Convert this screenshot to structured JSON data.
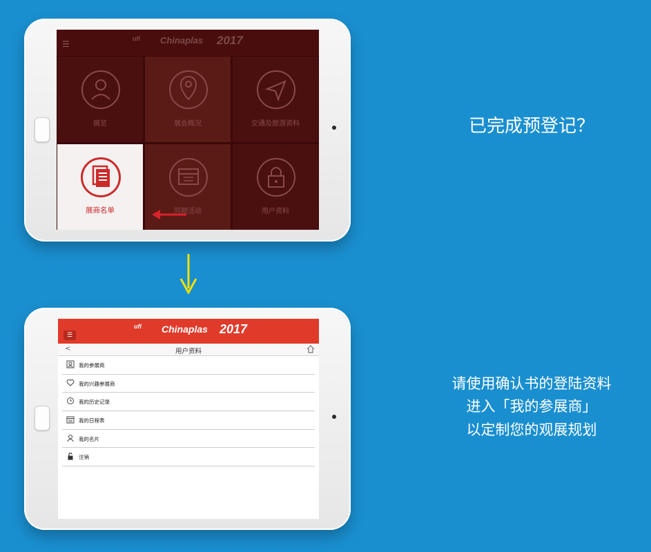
{
  "screen1": {
    "logo": {
      "ufi": "ufi",
      "brand": "Chinaplas",
      "year": "2017"
    },
    "tiles": [
      {
        "label": "展览",
        "icon": "person-icon"
      },
      {
        "label": "展会概况",
        "icon": "location-pin-icon"
      },
      {
        "label": "交通及旅游资料",
        "icon": "send-arrow-icon"
      },
      {
        "label": "展商名单",
        "icon": "document-icon"
      },
      {
        "label": "同期活动",
        "icon": "calendar-icon"
      },
      {
        "label": "用户资料",
        "icon": "lock-icon"
      }
    ]
  },
  "screen2": {
    "logo": {
      "ufi": "ufi",
      "brand": "Chinaplas",
      "year": "2017"
    },
    "title": "用户资料",
    "back": "<",
    "menu": [
      {
        "label": "我的参展商",
        "icon": "id-card-icon"
      },
      {
        "label": "我的兴趣参展商",
        "icon": "heart-icon"
      },
      {
        "label": "我的历史记录",
        "icon": "history-clock-icon"
      },
      {
        "label": "我的日程表",
        "icon": "calendar-icon"
      },
      {
        "label": "我的名片",
        "icon": "person-icon"
      },
      {
        "label": "注销",
        "icon": "lock-icon"
      }
    ]
  },
  "captions": {
    "question": "已完成预登记？",
    "line1": "请使用确认书的登陆资料",
    "line2": "进入「我的参展商」",
    "line3": "以定制您的观展规划"
  },
  "colors": {
    "background": "#1a8fd0",
    "accent_red": "#e03a2a",
    "arrow_yellow": "#f2e000"
  }
}
